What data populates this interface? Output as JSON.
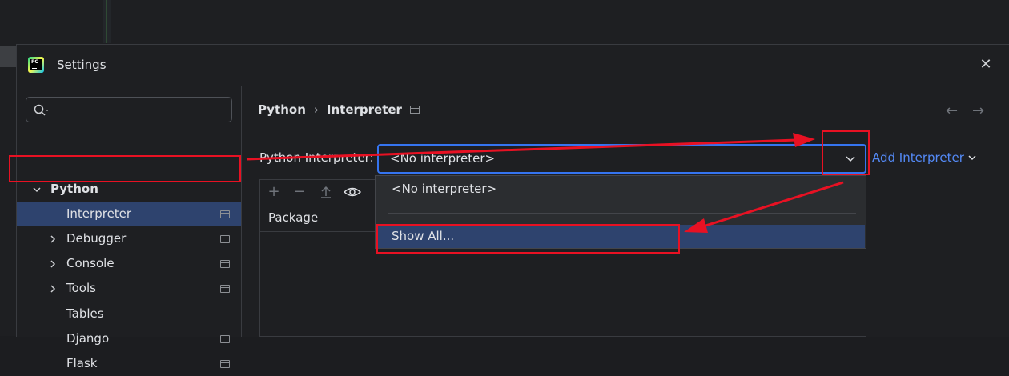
{
  "window": {
    "title": "Settings",
    "close_icon": "close-icon",
    "app_icon": "pycharm-icon"
  },
  "search": {
    "placeholder": "",
    "value": ""
  },
  "sidebar": {
    "items": [
      {
        "label": "Python",
        "expanded": true
      },
      {
        "label": "Interpreter",
        "selected": true
      },
      {
        "label": "Debugger"
      },
      {
        "label": "Console"
      },
      {
        "label": "Tools"
      },
      {
        "label": "Tables"
      },
      {
        "label": "Django"
      },
      {
        "label": "Flask"
      }
    ]
  },
  "breadcrumb": {
    "parent": "Python",
    "separator": "›",
    "current": "Interpreter"
  },
  "interpreter": {
    "label": "Python Interpreter:",
    "selected": "<No interpreter>",
    "add_label": "Add Interpreter"
  },
  "package_table": {
    "column": "Package"
  },
  "dropdown": {
    "options": [
      "<No interpreter>",
      "Show All..."
    ]
  },
  "colors": {
    "accent": "#3574f0",
    "selection": "#2e436e",
    "link": "#548af7",
    "annotation": "#e81123"
  }
}
